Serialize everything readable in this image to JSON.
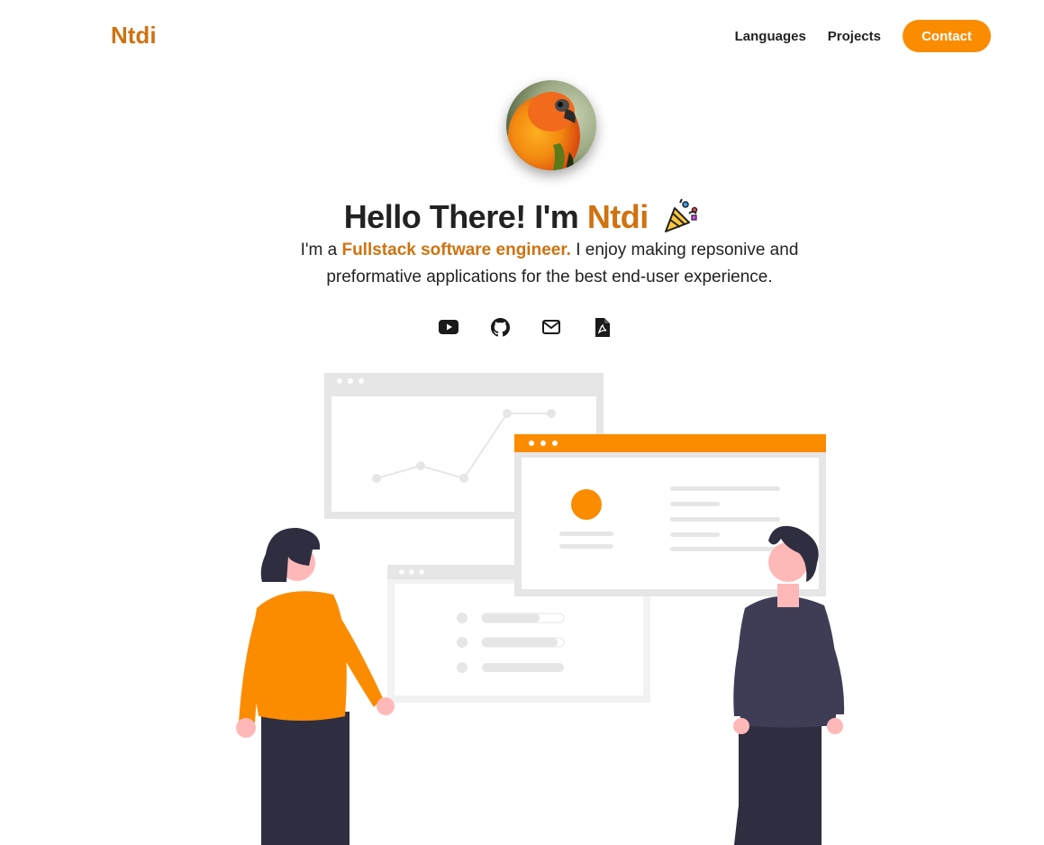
{
  "header": {
    "brand": "Ntdi",
    "nav": {
      "languages": "Languages",
      "projects": "Projects",
      "contact": "Contact"
    }
  },
  "hero": {
    "greeting": "Hello There! I'm ",
    "name": "Ntdi",
    "intro_prefix": "I'm a ",
    "role": "Fullstack software engineer.",
    "intro_suffix": " I enjoy making repsonive and preformative applications for the best end-user experience."
  },
  "socials": [
    {
      "icon": "youtube-icon"
    },
    {
      "icon": "github-icon"
    },
    {
      "icon": "mail-icon"
    },
    {
      "icon": "pdf-icon"
    }
  ],
  "colors": {
    "accent_text": "#d0720f",
    "accent_button": "#fb8c00",
    "dark_figure": "#2f2e41",
    "panel_grey": "#e6e6e6"
  }
}
